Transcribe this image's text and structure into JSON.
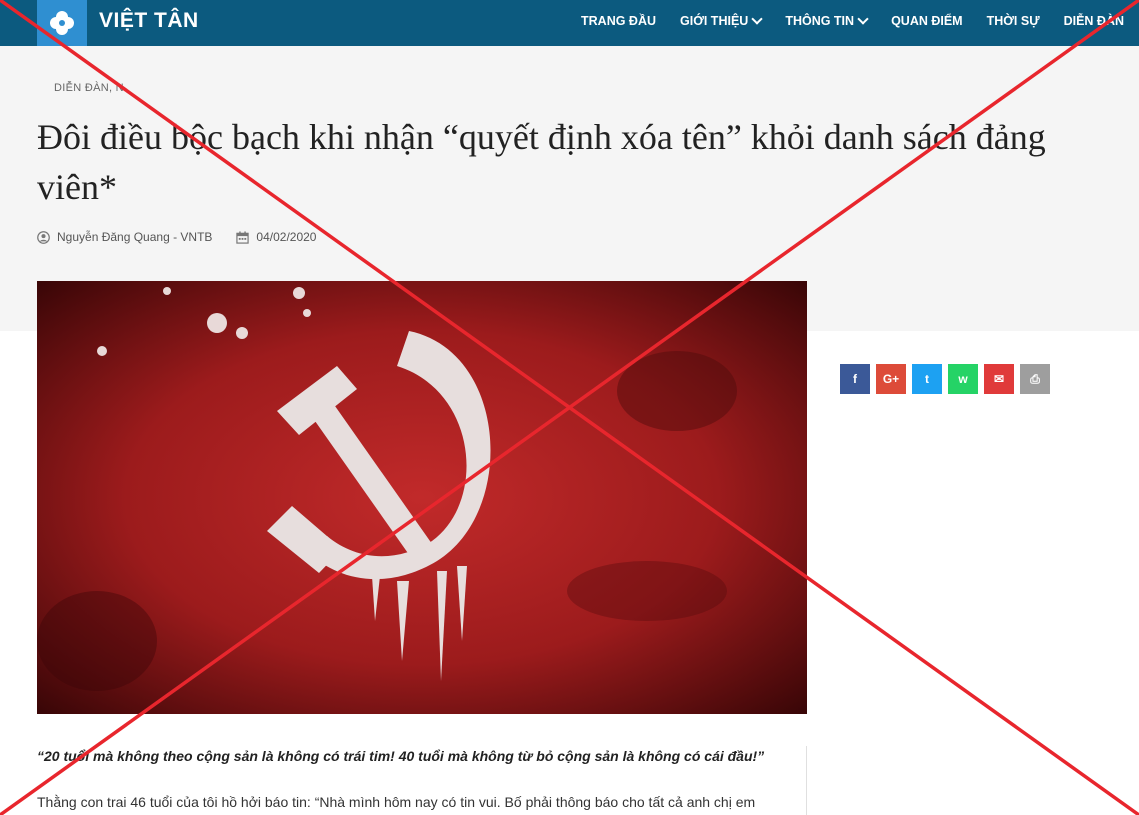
{
  "brand": {
    "name": "VIỆT TÂN",
    "logo_color": "#2f8fd1",
    "bar_color": "#0c5a7f"
  },
  "nav": {
    "items": [
      {
        "label": "TRANG ĐẦU",
        "has_dropdown": false
      },
      {
        "label": "GIỚI THIỆU",
        "has_dropdown": true
      },
      {
        "label": "THÔNG TIN",
        "has_dropdown": true
      },
      {
        "label": "QUAN ĐIỂM",
        "has_dropdown": false
      },
      {
        "label": "THỜI SỰ",
        "has_dropdown": false
      },
      {
        "label": "DIỄN ĐÀN",
        "has_dropdown": false
      }
    ]
  },
  "article": {
    "category": "DIỄN ĐÀN, N",
    "title": "Đôi điều bộc bạch khi nhận “quyết định xóa tên” khỏi danh sách đảng viên*",
    "author": "Nguyễn Đăng Quang - VNTB",
    "date": "04/02/2020",
    "quote": "“20 tuổi mà không theo cộng sản là không có trái tim! 40 tuổi mà không từ bỏ cộng sản là không có cái đầu!”",
    "first_paragraph": "Thằng con trai 46 tuổi của tôi hồ hởi báo tin: “Nhà mình hôm nay có tin vui. Bố phải thông báo cho tất cả anh chị em"
  },
  "share": {
    "buttons": [
      {
        "icon": "facebook-icon",
        "glyph": "f",
        "color": "#3b5998"
      },
      {
        "icon": "google-plus-icon",
        "glyph": "G+",
        "color": "#dd4b39"
      },
      {
        "icon": "twitter-icon",
        "glyph": "t",
        "color": "#1da1f2"
      },
      {
        "icon": "whatsapp-icon",
        "glyph": "w",
        "color": "#25d366"
      },
      {
        "icon": "email-icon",
        "glyph": "✉",
        "color": "#e03a3a"
      },
      {
        "icon": "print-icon",
        "glyph": "⎙",
        "color": "#9e9e9e"
      }
    ]
  },
  "overlay": {
    "cross_color": "#e8262d"
  }
}
